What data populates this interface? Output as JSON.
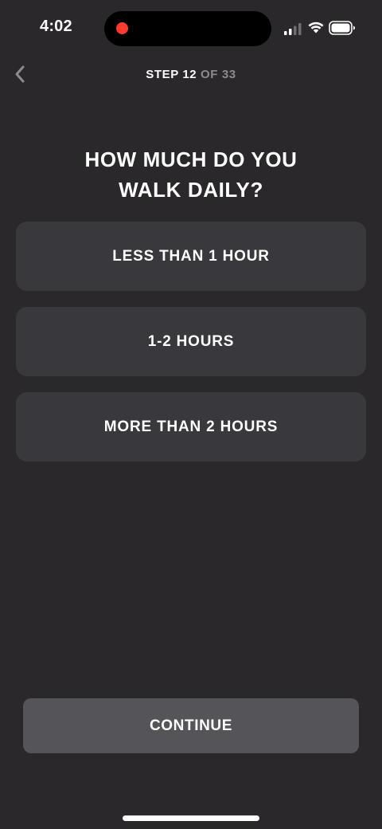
{
  "status_bar": {
    "time": "4:02",
    "recording_color": "#ff3b30",
    "icons": [
      "signal-icon",
      "wifi-icon",
      "battery-icon"
    ]
  },
  "header": {
    "back_icon": "chevron-left-icon",
    "step_label": "STEP 12",
    "step_total": "OF 33"
  },
  "question": {
    "line1": "HOW MUCH DO YOU",
    "line2": "WALK DAILY?"
  },
  "options": [
    {
      "label": "LESS THAN 1 HOUR"
    },
    {
      "label": "1-2 HOURS"
    },
    {
      "label": "MORE THAN 2 HOURS"
    }
  ],
  "footer": {
    "continue_label": "CONTINUE"
  },
  "colors": {
    "background": "#2a282b",
    "option_background": "#39383d",
    "continue_background": "#555458",
    "muted_text": "#8d8b90"
  }
}
